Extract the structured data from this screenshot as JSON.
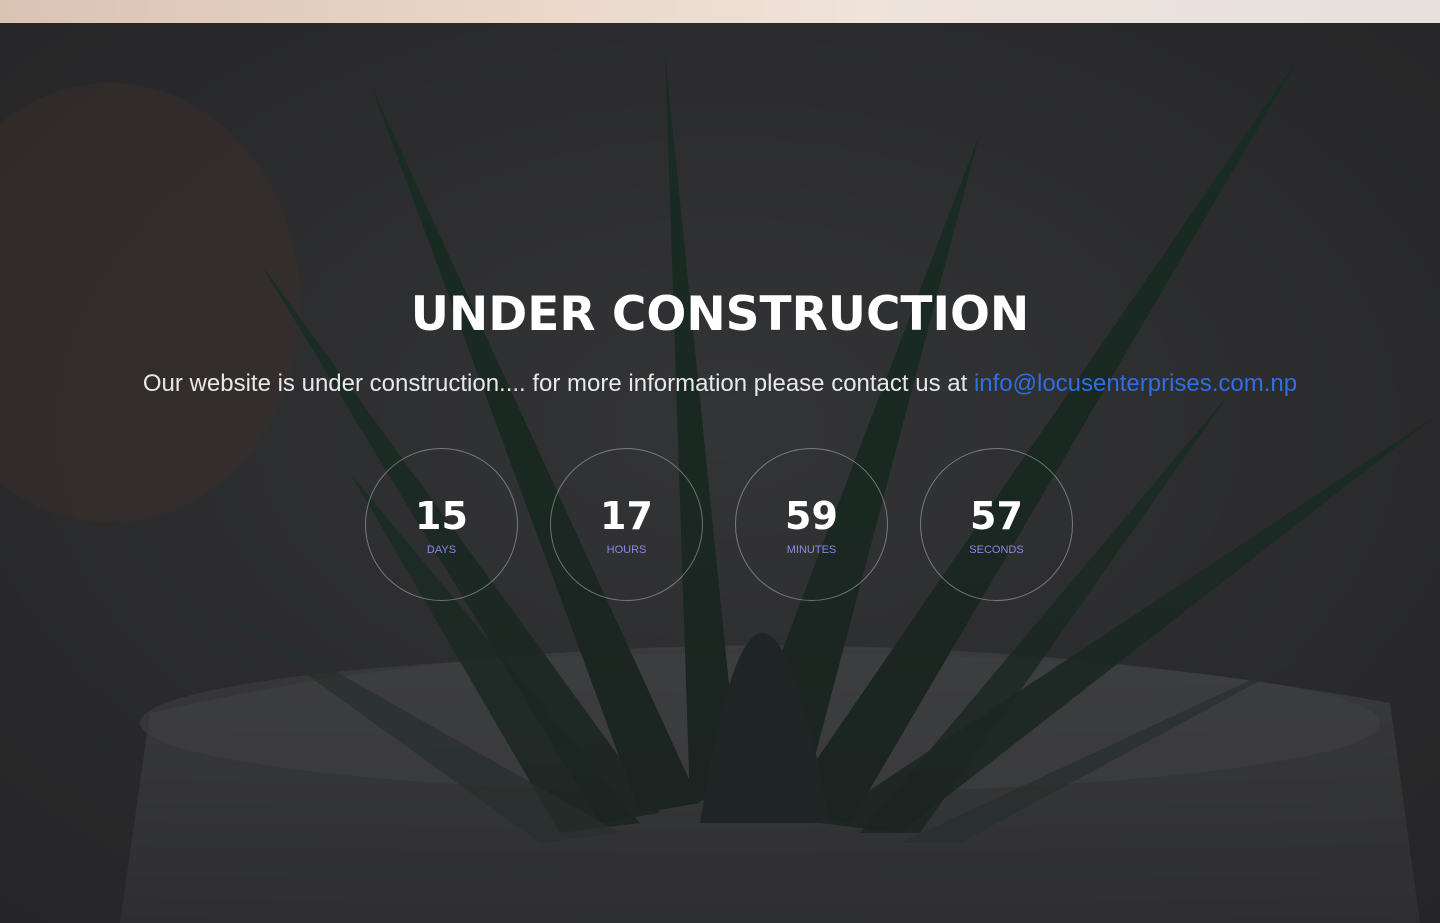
{
  "hero": {
    "title": "UNDER CONSTRUCTION",
    "message": "Our website is under construction.... for more information please contact us at ",
    "email": "info@locusenterprises.com.np"
  },
  "countdown": [
    {
      "value": "15",
      "unit": "DAYS"
    },
    {
      "value": "17",
      "unit": "HOURS"
    },
    {
      "value": "59",
      "unit": "MINUTES"
    },
    {
      "value": "57",
      "unit": "SECONDS"
    }
  ],
  "colors": {
    "link": "#2f6fe0",
    "unit_label": "#8f86e6",
    "overlay": "#141416"
  }
}
